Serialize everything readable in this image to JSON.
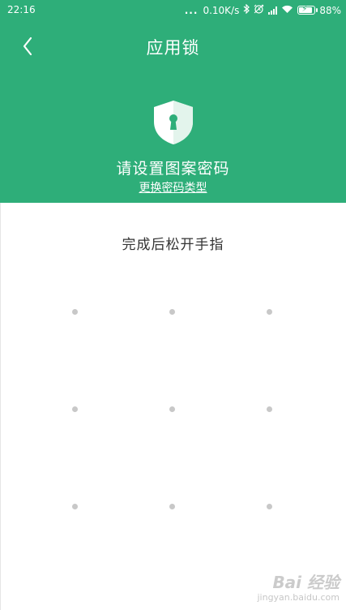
{
  "status_bar": {
    "time": "22:16",
    "dots": "...",
    "network_speed": "0.10K/s",
    "battery": "88%",
    "icons": [
      "bluetooth-icon",
      "alarm-icon",
      "signal-icon",
      "wifi-icon",
      "battery-charging-icon"
    ]
  },
  "header": {
    "title": "应用锁",
    "back_icon": "chevron-left-icon",
    "shield_icon": "shield-keyhole-icon",
    "prompt": "请设置图案密码",
    "change_link": "更换密码类型",
    "background": "#2eae79"
  },
  "main": {
    "hint": "完成后松开手指",
    "pattern_dots": 9,
    "dot_color": "#c8c8c8"
  },
  "watermark": {
    "brand": "Bai 经验",
    "url": "jingyan.baidu.com"
  }
}
